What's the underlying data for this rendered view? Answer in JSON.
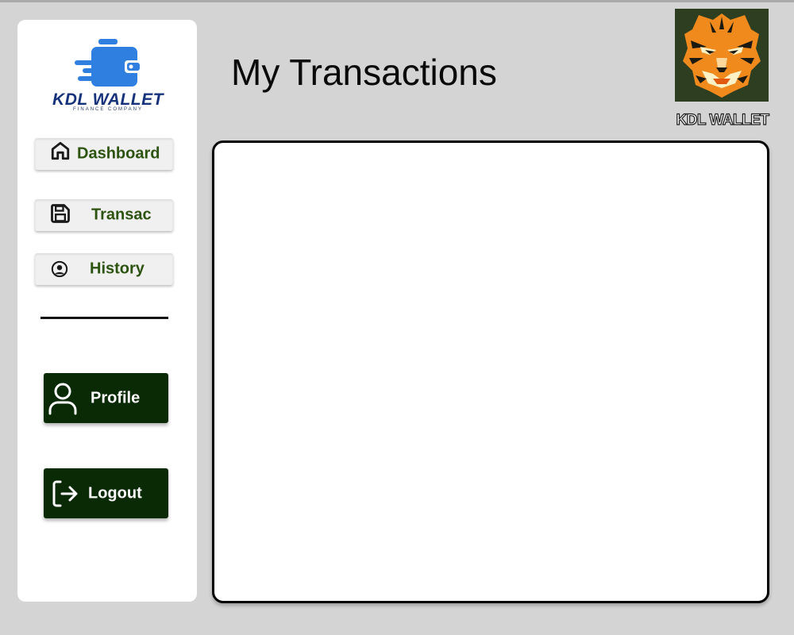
{
  "brand": {
    "name": "KDL WALLET",
    "tagline": "FINANCE COMPANY",
    "colors": {
      "primary": "#2f7fe0",
      "text": "#16327a"
    }
  },
  "sidebar": {
    "nav": [
      {
        "label": "Dashboard",
        "icon": "home-icon"
      },
      {
        "label": "Transac",
        "icon": "floppy-disk-icon"
      },
      {
        "label": "History",
        "icon": "user-circle-icon"
      }
    ],
    "profile_label": "Profile",
    "profile_icon": "user-icon",
    "logout_label": "Logout",
    "logout_icon": "logout-icon"
  },
  "header": {
    "title": "My Transactions"
  },
  "avatar": {
    "caption": "KDL WALLET",
    "icon": "tiger-icon"
  },
  "colors": {
    "background": "#d4d4d4",
    "nav_text": "#2c5310",
    "action_bg": "#0a2a06",
    "panel_border": "#000000"
  }
}
